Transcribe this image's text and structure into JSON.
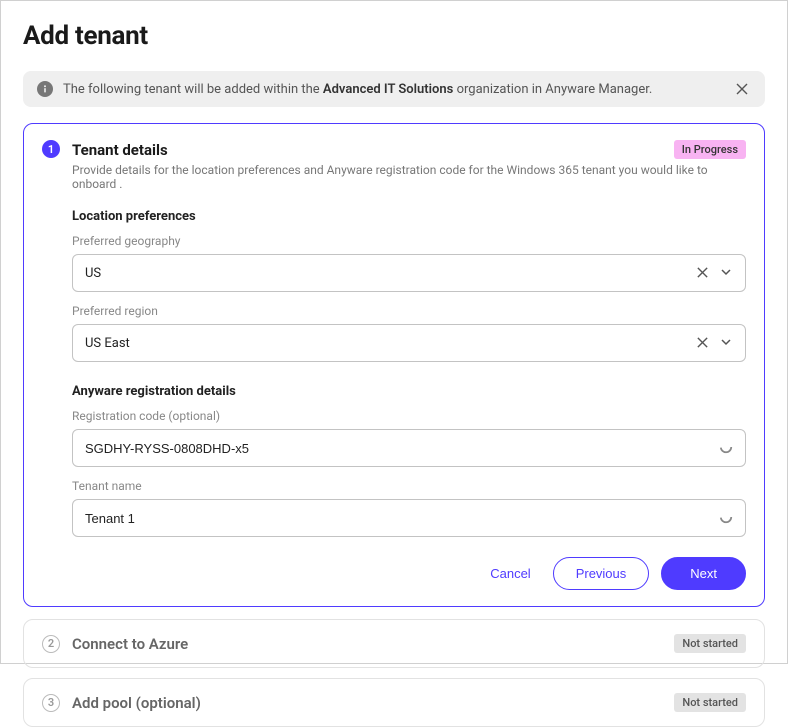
{
  "page": {
    "title": "Add tenant"
  },
  "banner": {
    "prefix": "The following tenant will be added within the ",
    "org_name": "Advanced IT Solutions",
    "suffix": " organization in Anyware Manager."
  },
  "step1": {
    "number": "1",
    "title": "Tenant details",
    "subtitle": "Provide details for the location preferences and Anyware registration code for the Windows 365 tenant you would like to onboard .",
    "badge": "In Progress",
    "location_section": "Location preferences",
    "geography_label": "Preferred geography",
    "geography_value": "US",
    "region_label": "Preferred region",
    "region_value": "US East",
    "registration_section": "Anyware registration details",
    "reg_code_label": "Registration code (optional)",
    "reg_code_value": "SGDHY-RYSS-0808DHD-x5",
    "tenant_name_label": "Tenant name",
    "tenant_name_value": "Tenant 1"
  },
  "actions": {
    "cancel": "Cancel",
    "previous": "Previous",
    "next": "Next"
  },
  "step2": {
    "number": "2",
    "title": "Connect to Azure",
    "badge": "Not started"
  },
  "step3": {
    "number": "3",
    "title": "Add pool (optional)",
    "badge": "Not started"
  }
}
